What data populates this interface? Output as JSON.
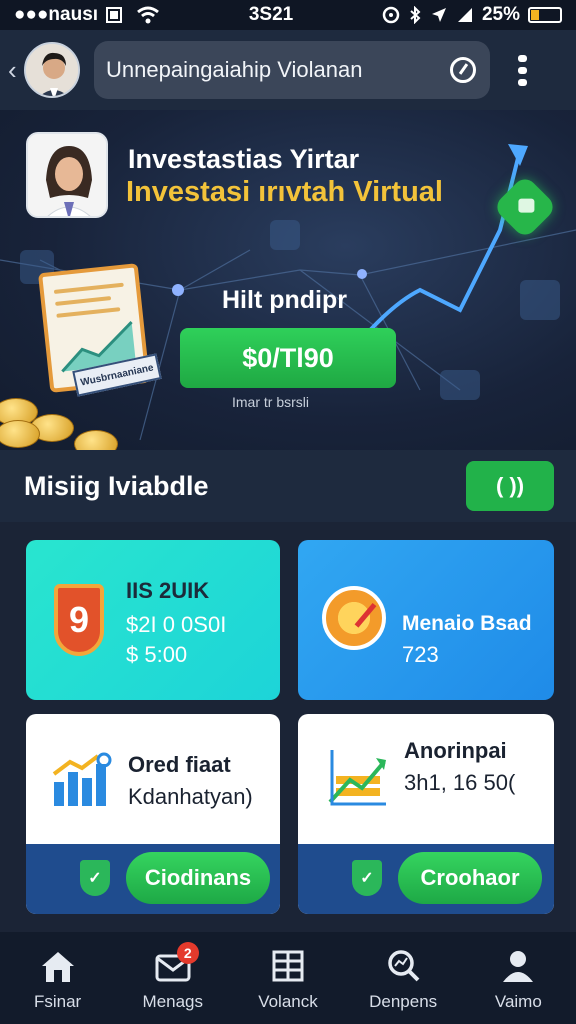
{
  "status_bar": {
    "carrier": "●●●nausı",
    "time": "3S21",
    "battery": "25%"
  },
  "header": {
    "search_text": "Unnepaingaiahip Violanan"
  },
  "hero": {
    "title_line1": "Investastias Yirtar",
    "title_line2": "Investasi ırıvtah  Virtual",
    "subtitle": "Hilt pndipr",
    "button_label": "$0/Tl90",
    "caption": "Imar tr bsrsli",
    "doc_badge": "Wusbrnaaniane"
  },
  "section": {
    "title": "Misiig Iviabdle",
    "button_label": "( ))"
  },
  "cards": [
    {
      "icon": "9",
      "line1": "IIS 2UIK",
      "line2": "$2I 0 0S0I",
      "line3": "$ 5:00"
    },
    {
      "line1": "Menaio Bsad",
      "line2": "723"
    },
    {
      "line1": "Ored fiaat",
      "line2": "Kdanhatyan)",
      "button": "Ciodinans"
    },
    {
      "line1": "Anorinpai",
      "line2": "3h1, 16 50(",
      "button": "Croohaor"
    }
  ],
  "nav": [
    {
      "label": "Fsinar"
    },
    {
      "label": "Menags",
      "badge": "2"
    },
    {
      "label": "Volanck"
    },
    {
      "label": "Denpens"
    },
    {
      "label": "Vaimo"
    }
  ]
}
